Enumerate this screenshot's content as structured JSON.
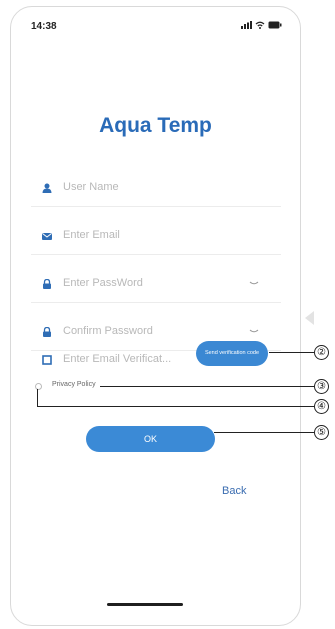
{
  "status_bar": {
    "time": "14:38"
  },
  "app": {
    "title": "Aqua Temp"
  },
  "form": {
    "user_name_placeholder": "User Name",
    "email_placeholder": "Enter Email",
    "password_placeholder": "Enter PassWord",
    "confirm_password_placeholder": "Confirm Password",
    "verification_placeholder": "Enter Email Verificat...",
    "send_code_label": "Send verification code",
    "privacy_label": "Privacy Policy",
    "ok_label": "OK",
    "back_label": "Back"
  },
  "callouts": [
    "②",
    "③",
    "④",
    "⑤"
  ],
  "colors": {
    "accent": "#3b88d3",
    "title": "#2a6bb8",
    "icon": "#2f6db5"
  }
}
